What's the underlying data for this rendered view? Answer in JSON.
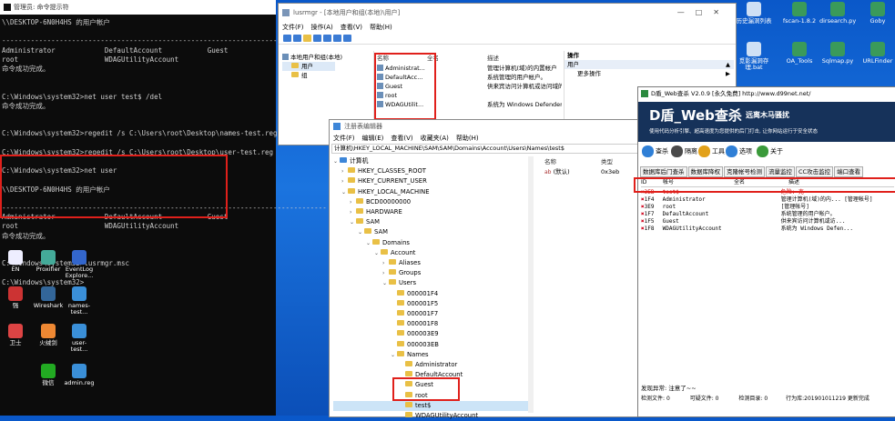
{
  "cmd": {
    "title": "管理员: 命令提示符",
    "lines": [
      "\\\\DESKTOP-6N0H4HS 的用户帐户",
      "",
      "-------------------------------------------------------------------------------",
      "Administrator            DefaultAccount           Guest",
      "root                     WDAGUtilityAccount",
      "命令成功完成。",
      "",
      "",
      "C:\\Windows\\system32>net user test$ /del",
      "命令成功完成。",
      "",
      "",
      "C:\\Windows\\system32>regedit /s C:\\Users\\root\\Desktop\\names-test.reg",
      "",
      "C:\\Windows\\system32>regedit /s C:\\Users\\root\\Desktop\\user-test.reg",
      "",
      "C:\\Windows\\system32>net user",
      "",
      "\\\\DESKTOP-6N0H4HS 的用户帐户",
      "",
      "-------------------------------------------------------------------------------",
      "Administrator            DefaultAccount           Guest",
      "root                     WDAGUtilityAccount",
      "命令成功完成。",
      "",
      "",
      "C:\\Windows\\system32>lusrmgr.msc",
      "",
      "C:\\Windows\\system32>"
    ]
  },
  "desktop_icons": [
    {
      "label": "EN"
    },
    {
      "label": "Proxifier"
    },
    {
      "label": "EventLog Explore..."
    },
    {
      "label": "强"
    },
    {
      "label": "Wireshark"
    },
    {
      "label": "names-test..."
    },
    {
      "label": "卫士"
    },
    {
      "label": "火绒剑"
    },
    {
      "label": "user-test..."
    },
    {
      "label": "微信"
    },
    {
      "label": "admin.reg"
    }
  ],
  "desktop_right_icons": [
    {
      "label": "历史漏洞列表"
    },
    {
      "label": "fscan-1.8.2"
    },
    {
      "label": "dirsearch.py"
    },
    {
      "label": "Goby"
    },
    {
      "label": "觅影漏洞存 理.bat"
    },
    {
      "label": "OA_Tools"
    },
    {
      "label": "Sqlmap.py"
    },
    {
      "label": "URLFinder"
    }
  ],
  "lusrmgr": {
    "title": "lusrmgr - [本地用户和组(本地)\\用户]",
    "menu": [
      "文件(F)",
      "操作(A)",
      "查看(V)",
      "帮助(H)"
    ],
    "tree_root": "本地用户和组(本地)",
    "tree_items": [
      "用户",
      "组"
    ],
    "col_name": "名称",
    "col_fullname": "全名",
    "col_desc": "描述",
    "users": [
      {
        "name": "Administrat...",
        "desc": "管理计算机(域)的内置帐户"
      },
      {
        "name": "DefaultAcc...",
        "desc": "系统管理的用户帐户。"
      },
      {
        "name": "Guest",
        "desc": "供来宾访问计算机或访问域的内..."
      },
      {
        "name": "root",
        "desc": ""
      },
      {
        "name": "WDAGUtilit...",
        "desc": "系统为 Windows Defender..."
      }
    ],
    "actions_title": "操作",
    "actions_sel": "用户",
    "actions_more": "更多操作"
  },
  "regedit": {
    "title": "注册表编辑器",
    "menu": [
      "文件(F)",
      "编辑(E)",
      "查看(V)",
      "收藏夹(A)",
      "帮助(H)"
    ],
    "path": "计算机\\HKEY_LOCAL_MACHINE\\SAM\\SAM\\Domains\\Account\\Users\\Names\\test$",
    "tree": [
      {
        "label": "计算机",
        "level": 0,
        "caret": "v"
      },
      {
        "label": "HKEY_CLASSES_ROOT",
        "level": 1,
        "caret": ">"
      },
      {
        "label": "HKEY_CURRENT_USER",
        "level": 1,
        "caret": ">"
      },
      {
        "label": "HKEY_LOCAL_MACHINE",
        "level": 1,
        "caret": "v"
      },
      {
        "label": "BCD00000000",
        "level": 2,
        "caret": ">"
      },
      {
        "label": "HARDWARE",
        "level": 2,
        "caret": ">"
      },
      {
        "label": "SAM",
        "level": 2,
        "caret": "v"
      },
      {
        "label": "SAM",
        "level": 3,
        "caret": "v"
      },
      {
        "label": "Domains",
        "level": 4,
        "caret": "v"
      },
      {
        "label": "Account",
        "level": 5,
        "caret": "v"
      },
      {
        "label": "Aliases",
        "level": 6,
        "caret": ">"
      },
      {
        "label": "Groups",
        "level": 6,
        "caret": ">"
      },
      {
        "label": "Users",
        "level": 6,
        "caret": "v"
      },
      {
        "label": "000001F4",
        "level": 7,
        "caret": ""
      },
      {
        "label": "000001F5",
        "level": 7,
        "caret": ""
      },
      {
        "label": "000001F7",
        "level": 7,
        "caret": ""
      },
      {
        "label": "000001F8",
        "level": 7,
        "caret": ""
      },
      {
        "label": "000003E9",
        "level": 7,
        "caret": ""
      },
      {
        "label": "000003EB",
        "level": 7,
        "caret": ""
      },
      {
        "label": "Names",
        "level": 7,
        "caret": "v"
      },
      {
        "label": "Administrator",
        "level": 8,
        "caret": ""
      },
      {
        "label": "DefaultAccount",
        "level": 8,
        "caret": ""
      },
      {
        "label": "Guest",
        "level": 8,
        "caret": ""
      },
      {
        "label": "root",
        "level": 8,
        "caret": ""
      },
      {
        "label": "test$",
        "level": 8,
        "caret": ""
      },
      {
        "label": "WDAGUtilityAccount",
        "level": 8,
        "caret": ""
      }
    ],
    "col_name": "名称",
    "col_type": "类型",
    "value_name": "(默认)",
    "value_type": "0x3eb"
  },
  "dshield": {
    "title": "D盾_Web查杀 V2.0.9 [永久免费] http://www.d99net.net/",
    "banner_title": "D盾_Web查杀",
    "banner_sub": "远离木马骚扰",
    "banner_desc": "使用代码分析引擎、超高速度为您提供的后门打击, 让你网站运行于安全状态",
    "tabs": [
      "查杀",
      "隔离",
      "工具",
      "选项",
      "关于"
    ],
    "subtabs": [
      "数据库后门查杀",
      "数据库降权",
      "克隆帐号检测",
      "流量监控",
      "CC攻击监控",
      "端口查看"
    ],
    "cols": [
      "ID",
      "帐号",
      "全名",
      "描述"
    ],
    "rows": [
      {
        "id": "3EB",
        "account": "test$",
        "desc": "危险: 克"
      },
      {
        "id": "1F4",
        "account": "Administrator",
        "desc": "管理计算机(域)的内...  [管理帐号]"
      },
      {
        "id": "3E9",
        "account": "root",
        "desc": "[管理帐号]"
      },
      {
        "id": "1F7",
        "account": "DefaultAccount",
        "desc": "系统管理的用户帐户。"
      },
      {
        "id": "1F5",
        "account": "Guest",
        "desc": "供来宾访问计算机或访..."
      },
      {
        "id": "1F8",
        "account": "WDAGUtilityAccount",
        "desc": "系统为 Windows Defen..."
      }
    ],
    "status_found": "发现异常: 注意了~~",
    "status_files_label": "检测文件:",
    "status_files": "0",
    "status_suspect_label": "可疑文件:",
    "status_suspect": "0",
    "status_dirs_label": "检测目录:",
    "status_dirs": "0",
    "status_rules": "行为库:201901011219",
    "status_update": "更新完成"
  },
  "colors": {
    "highlight": "#e0201b",
    "dshield_banner": "#16325a"
  }
}
